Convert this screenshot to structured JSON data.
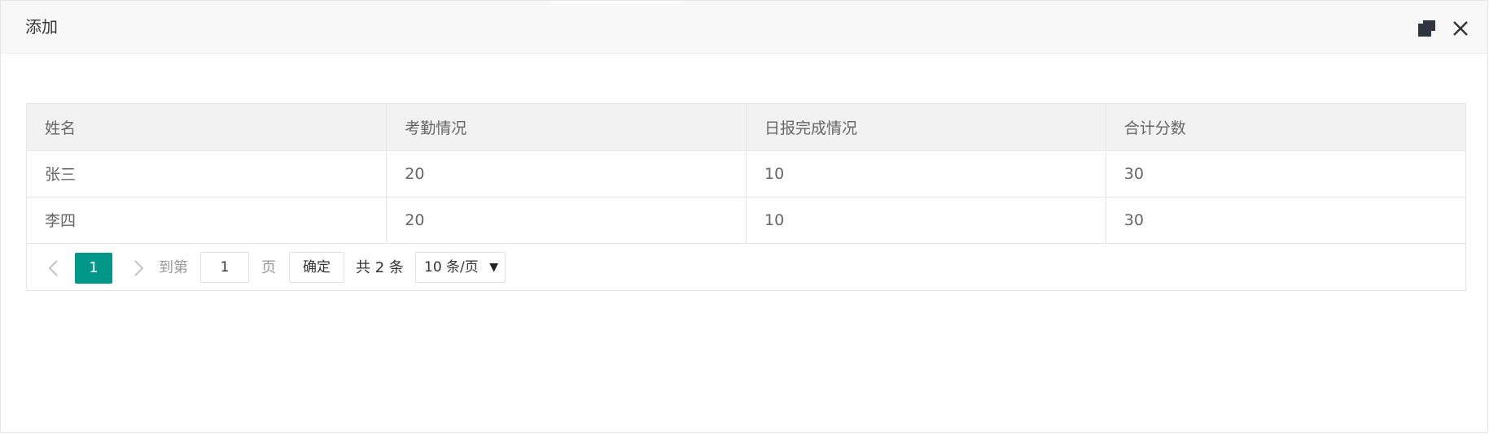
{
  "dialog": {
    "title": "添加"
  },
  "table": {
    "columns": [
      "姓名",
      "考勤情况",
      "日报完成情况",
      "合计分数"
    ],
    "rows": [
      [
        "张三",
        "20",
        "10",
        "30"
      ],
      [
        "李四",
        "20",
        "10",
        "30"
      ]
    ]
  },
  "pager": {
    "current_page": "1",
    "goto_label": "到第",
    "goto_value": "1",
    "page_label": "页",
    "confirm_label": "确定",
    "total_label": "共 2 条",
    "page_size": "10 条/页",
    "page_size_caret": "▼",
    "accent_color": "#009688"
  },
  "icons": {
    "restore": "restore-window-icon",
    "close": "close-icon",
    "prev": "chevron-left-icon",
    "next": "chevron-right-icon"
  }
}
